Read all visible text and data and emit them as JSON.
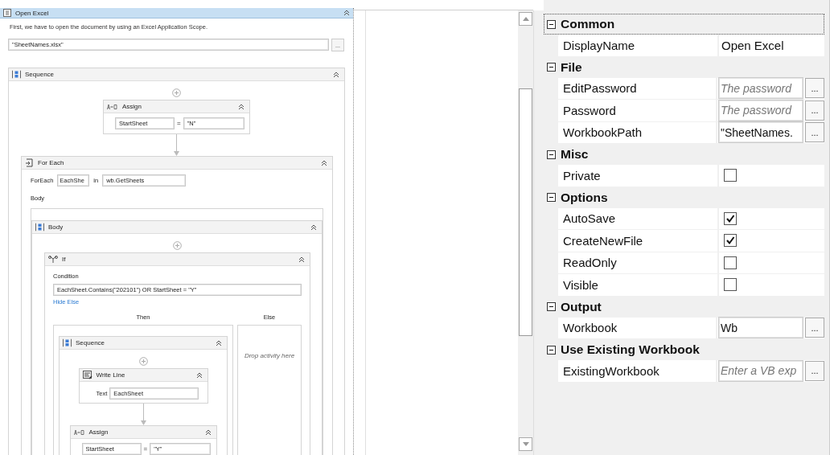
{
  "designer": {
    "kind": "scope",
    "title": "Open Excel",
    "description": "First, we have to open the document by using an Excel Application Scope.",
    "path": "\"SheetNames.xlsx\"",
    "path_button": "...",
    "body": {
      "kind": "sequence",
      "title": "Sequence",
      "activities": [
        {
          "kind": "assign",
          "title": "Assign",
          "to": "StartSheet",
          "operator": "=",
          "value": "\"N\""
        },
        {
          "kind": "foreach",
          "title": "For Each",
          "label": "ForEach",
          "variable": "EachShe",
          "in_label": "in",
          "collection": "wb.GetSheets",
          "body_label": "Body",
          "body": {
            "kind": "sequence",
            "title": "Body",
            "activities": [
              {
                "kind": "if",
                "title": "If",
                "condition_label": "Condition",
                "condition": "EachSheet.Contains(\"202101\") OR StartSheet = \"Y\"",
                "toggle_link": "Hide Else",
                "then_label": "Then",
                "else_label": "Else",
                "else_placeholder": "Drop activity here",
                "then": {
                  "kind": "sequence",
                  "title": "Sequence",
                  "activities": [
                    {
                      "kind": "writeline",
                      "title": "Write Line",
                      "label": "Text",
                      "value": "EachSheet"
                    },
                    {
                      "kind": "assign",
                      "title": "Assign",
                      "to": "StartSheet",
                      "operator": "=",
                      "value": "\"Y\""
                    }
                  ]
                }
              }
            ]
          }
        }
      ]
    }
  },
  "properties": {
    "categories": [
      {
        "name": "Common",
        "expanded": true,
        "selected": true,
        "rows": [
          {
            "kind": "text",
            "name": "DisplayName",
            "value": "Open Excel"
          }
        ]
      },
      {
        "name": "File",
        "expanded": true,
        "selected": false,
        "rows": [
          {
            "kind": "expression",
            "name": "EditPassword",
            "placeholder": "The password",
            "button": "..."
          },
          {
            "kind": "expression",
            "name": "Password",
            "placeholder": "The password",
            "button": "..."
          },
          {
            "kind": "expression",
            "name": "WorkbookPath",
            "value": "\"SheetNames.",
            "button": "..."
          }
        ]
      },
      {
        "name": "Misc",
        "expanded": true,
        "selected": false,
        "rows": [
          {
            "kind": "checkbox",
            "name": "Private",
            "checked": false
          }
        ]
      },
      {
        "name": "Options",
        "expanded": true,
        "selected": false,
        "rows": [
          {
            "kind": "checkbox",
            "name": "AutoSave",
            "checked": true
          },
          {
            "kind": "checkbox",
            "name": "CreateNewFile",
            "checked": true
          },
          {
            "kind": "checkbox",
            "name": "ReadOnly",
            "checked": false
          },
          {
            "kind": "checkbox",
            "name": "Visible",
            "checked": false
          }
        ]
      },
      {
        "name": "Output",
        "expanded": true,
        "selected": false,
        "rows": [
          {
            "kind": "expression",
            "name": "Workbook",
            "value": "Wb",
            "button": "..."
          }
        ]
      },
      {
        "name": "Use Existing Workbook",
        "expanded": true,
        "selected": false,
        "rows": [
          {
            "kind": "expression",
            "name": "ExistingWorkbook",
            "placeholder": "Enter a VB exp",
            "button": "..."
          }
        ]
      }
    ]
  }
}
